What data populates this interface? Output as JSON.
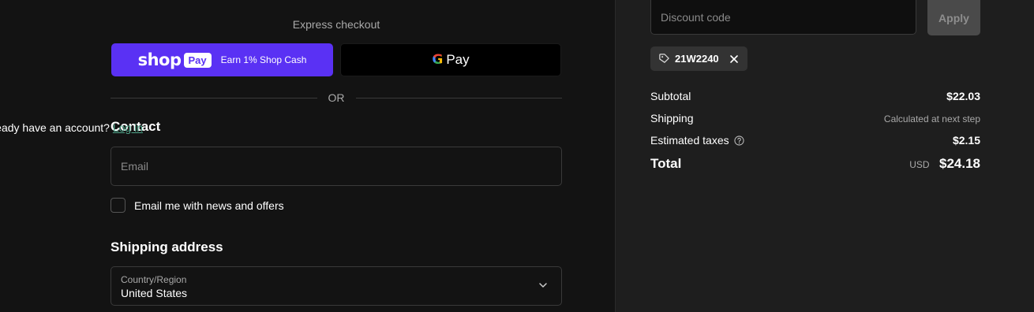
{
  "express_checkout": {
    "label": "Express checkout",
    "shop_pay": {
      "logo_text": "shop",
      "pill_text": "Pay",
      "sub_text": "Earn 1% Shop Cash"
    },
    "google_pay": {
      "g_text": "G",
      "pay_text": "Pay"
    },
    "divider_text": "OR"
  },
  "contact": {
    "heading": "Contact",
    "account_prompt": "Already have an account?",
    "login_link": "Log in",
    "email_placeholder": "Email",
    "newsletter_label": "Email me with news and offers"
  },
  "shipping": {
    "heading": "Shipping address",
    "country_label": "Country/Region",
    "country_value": "United States"
  },
  "order_summary": {
    "discount_placeholder": "Discount code",
    "apply_label": "Apply",
    "applied_code": "21W2240",
    "subtotal_label": "Subtotal",
    "subtotal_value": "$22.03",
    "shipping_label": "Shipping",
    "shipping_value": "Calculated at next step",
    "taxes_label": "Estimated taxes",
    "taxes_value": "$2.15",
    "total_label": "Total",
    "total_currency": "USD",
    "total_value": "$24.18"
  },
  "colors": {
    "shop_pay_purple": "#5a31f4",
    "link_green": "#4fa58a",
    "page_background": "#131313",
    "summary_background": "#1e1e1e"
  },
  "icons": [
    "g-logo-icon",
    "chevron-down-icon",
    "tag-icon",
    "close-icon",
    "help-circle-icon"
  ]
}
